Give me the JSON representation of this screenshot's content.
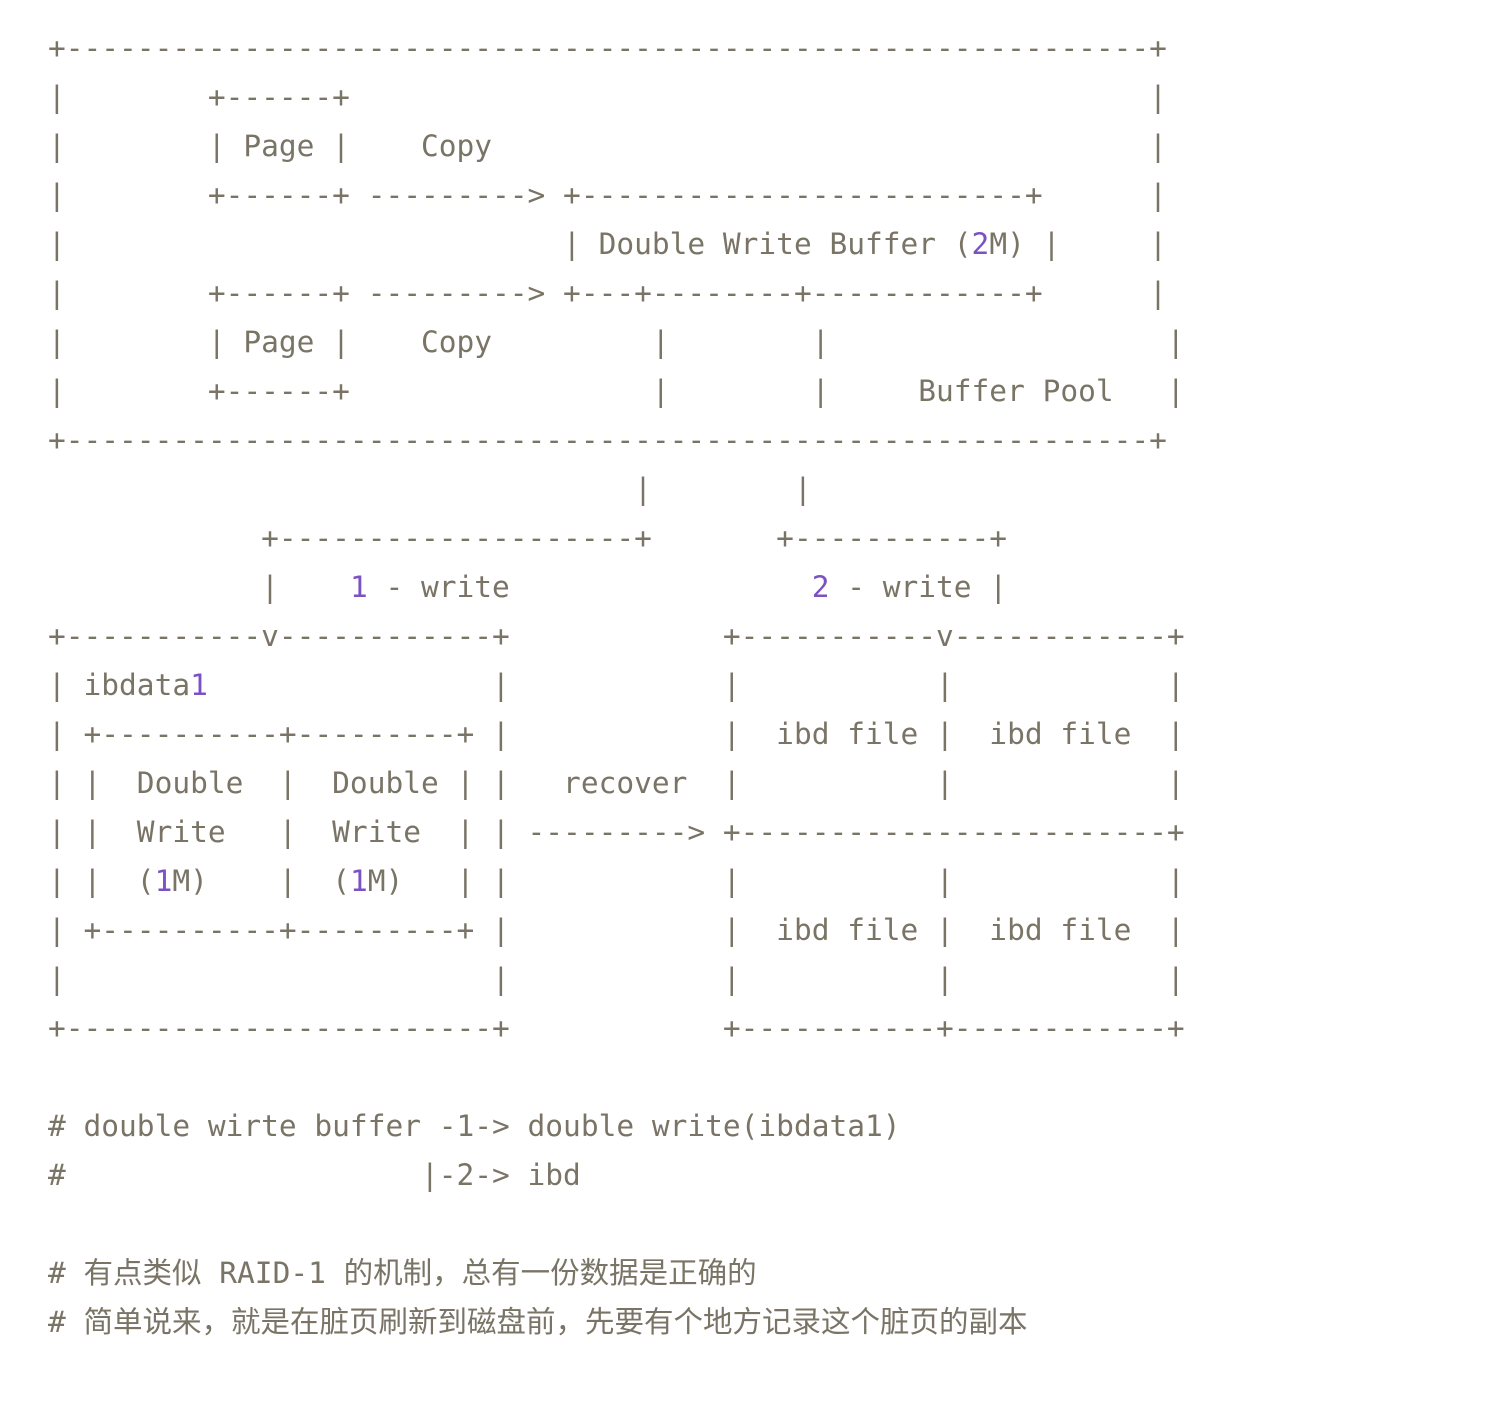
{
  "diagram_lines": [
    "+-------------------------------------------------------------+",
    "|        +------+                                             |",
    "|        | Page |    Copy                                     |",
    "|        +------+ ---------> +-------------------------+      |",
    "|                            | Double Write Buffer (2M) |     |",
    "|        +------+ ---------> +---+--------+------------+      |",
    "|        | Page |    Copy         |        |                   |",
    "|        +------+                 |        |     Buffer Pool   |",
    "+-------------------------------------------------------------+",
    "                                 |        |",
    "            +--------------------+       +-----------+",
    "            |    1 - write                 2 - write |",
    "+-----------v------------+            +-----------v------------+",
    "| ibdata1                |            |           |            |",
    "| +----------+---------+ |            |  ibd file |  ibd file  |",
    "| |  Double  |  Double | |   recover  |           |            |",
    "| |  Write   |  Write  | | ---------> +------------------------+",
    "| |  (1M)    |  (1M)   | |            |           |            |",
    "| +----------+---------+ |            |  ibd file |  ibd file  |",
    "|                        |            |           |            |",
    "+------------------------+            +-----------+------------+",
    "",
    "# double wirte buffer -1-> double write(ibdata1)",
    "#                    |-2-> ibd",
    "",
    "# 有点类似 RAID-1 的机制，总有一份数据是正确的",
    "# 简单说来，就是在脏页刷新到磁盘前，先要有个地方记录这个脏页的副本"
  ],
  "colors": {
    "text": "#7a7466",
    "number_highlight": "#7b52c4",
    "background": "#ffffff"
  }
}
